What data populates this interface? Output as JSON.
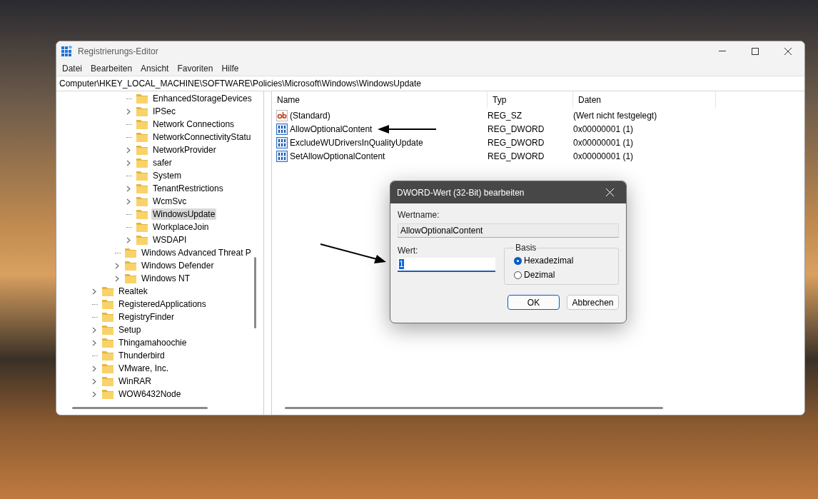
{
  "window": {
    "title": "Registrierungs-Editor"
  },
  "menu": [
    "Datei",
    "Bearbeiten",
    "Ansicht",
    "Favoriten",
    "Hilfe"
  ],
  "address": "Computer\\HKEY_LOCAL_MACHINE\\SOFTWARE\\Policies\\Microsoft\\Windows\\WindowsUpdate",
  "tree": {
    "items": [
      {
        "children": [
          {
            "children": [
              {
                "children": [
                  {
                    "label": "EnhancedStorageDevices",
                    "expandable": false,
                    "selected": false
                  },
                  {
                    "label": "IPSec",
                    "expandable": true,
                    "selected": false
                  },
                  {
                    "label": "Network Connections",
                    "expandable": false,
                    "selected": false
                  },
                  {
                    "label": "NetworkConnectivityStatu",
                    "expandable": false,
                    "selected": false
                  },
                  {
                    "label": "NetworkProvider",
                    "expandable": true,
                    "selected": false
                  },
                  {
                    "label": "safer",
                    "expandable": true,
                    "selected": false
                  },
                  {
                    "label": "System",
                    "expandable": false,
                    "selected": false
                  },
                  {
                    "label": "TenantRestrictions",
                    "expandable": true,
                    "selected": false
                  },
                  {
                    "label": "WcmSvc",
                    "expandable": true,
                    "selected": false
                  },
                  {
                    "label": "WindowsUpdate",
                    "expandable": false,
                    "selected": true
                  },
                  {
                    "label": "WorkplaceJoin",
                    "expandable": false,
                    "selected": false
                  },
                  {
                    "label": "WSDAPI",
                    "expandable": true,
                    "selected": false
                  }
                ]
              },
              {
                "label": "Windows Advanced Threat P",
                "expandable": false,
                "selected": false
              },
              {
                "label": "Windows Defender",
                "expandable": true,
                "selected": false
              },
              {
                "label": "Windows NT",
                "expandable": true,
                "selected": false
              }
            ]
          }
        ]
      },
      {
        "label": "Realtek",
        "expandable": true,
        "selected": false
      },
      {
        "label": "RegisteredApplications",
        "expandable": false,
        "selected": false
      },
      {
        "label": "RegistryFinder",
        "expandable": false,
        "selected": false
      },
      {
        "label": "Setup",
        "expandable": true,
        "selected": false
      },
      {
        "label": "Thingamahoochie",
        "expandable": true,
        "selected": false
      },
      {
        "label": "Thunderbird",
        "expandable": false,
        "selected": false
      },
      {
        "label": "VMware, Inc.",
        "expandable": true,
        "selected": false
      },
      {
        "label": "WinRAR",
        "expandable": true,
        "selected": false
      },
      {
        "label": "WOW6432Node",
        "expandable": true,
        "selected": false
      }
    ]
  },
  "values": {
    "columns": [
      "Name",
      "Typ",
      "Daten"
    ],
    "rows": [
      {
        "kind": "string",
        "name": "(Standard)",
        "type": "REG_SZ",
        "data": "(Wert nicht festgelegt)"
      },
      {
        "kind": "dword",
        "name": "AllowOptionalContent",
        "type": "REG_DWORD",
        "data": "0x00000001 (1)"
      },
      {
        "kind": "dword",
        "name": "ExcludeWUDriversInQualityUpdate",
        "type": "REG_DWORD",
        "data": "0x00000001 (1)"
      },
      {
        "kind": "dword",
        "name": "SetAllowOptionalContent",
        "type": "REG_DWORD",
        "data": "0x00000001 (1)"
      }
    ]
  },
  "dialog": {
    "title": "DWORD-Wert (32-Bit) bearbeiten",
    "name_label": "Wertname:",
    "name_value": "AllowOptionalContent",
    "value_label": "Wert:",
    "value": "1",
    "value_highlighted": true,
    "base_label": "Basis",
    "bases": [
      {
        "label": "Hexadezimal",
        "selected": true
      },
      {
        "label": "Dezimal",
        "selected": false
      }
    ],
    "buttons": [
      {
        "label": "OK",
        "default": true
      },
      {
        "label": "Abbrechen",
        "default": false
      }
    ]
  }
}
